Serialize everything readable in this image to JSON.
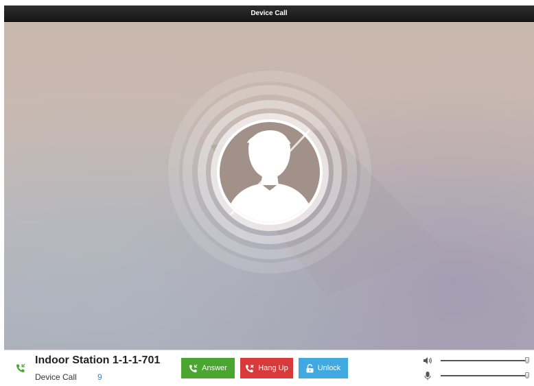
{
  "window": {
    "title": "Device Call"
  },
  "call": {
    "station_name": "Indoor Station 1-1-1-701",
    "call_type": "Device Call",
    "count": "9"
  },
  "buttons": {
    "answer_label": "Answer",
    "hangup_label": "Hang Up",
    "unlock_label": "Unlock"
  },
  "audio": {
    "speaker_volume_level": 1.0,
    "microphone_volume_level": 1.0
  },
  "colors": {
    "answer": "#4aa62e",
    "hangup": "#d83a3a",
    "unlock": "#3fa9e0",
    "count_text": "#2f86d6",
    "call_icon": "#4aa62e"
  },
  "icons": {
    "caller": "person-silhouette-icon",
    "call": "incoming-call-icon",
    "answer": "phone-icon",
    "hangup": "phone-hangup-icon",
    "unlock": "unlock-icon",
    "speaker": "speaker-icon",
    "microphone": "microphone-icon"
  }
}
